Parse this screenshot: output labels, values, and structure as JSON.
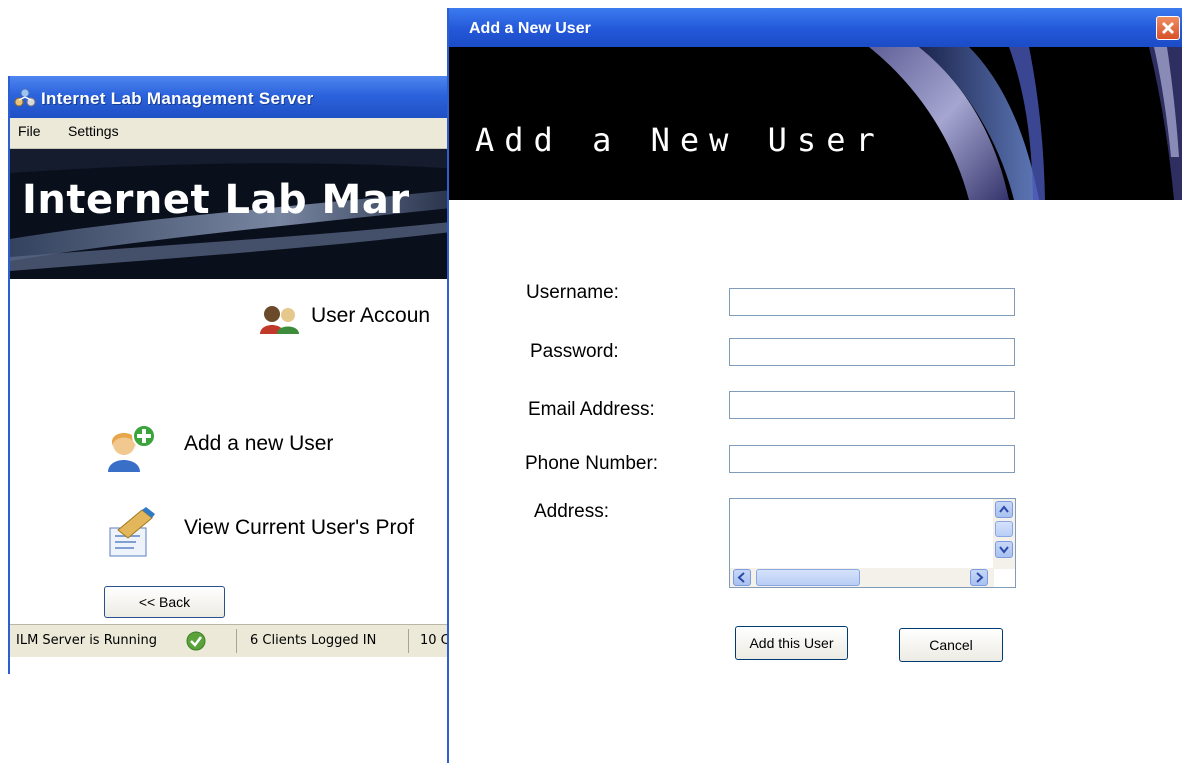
{
  "main_window": {
    "title": "Internet Lab Management Server",
    "menu": [
      "File",
      "Settings"
    ],
    "banner_text": "Internet Lab Mar",
    "section_heading": "User Accoun",
    "actions": [
      {
        "label": "Add a new User",
        "icon": "add-user-icon"
      },
      {
        "label": "View Current User's Prof",
        "icon": "edit-profile-icon"
      }
    ],
    "back_label": "<< Back",
    "status": {
      "server": "ILM Server is Running",
      "clients": "6 Clients Logged IN",
      "third": "10 C"
    }
  },
  "dialog": {
    "title": "Add a New User",
    "banner_text": "Add a New User",
    "fields": {
      "username": "Username:",
      "password": "Password:",
      "email": "Email Address:",
      "phone": "Phone Number:",
      "address": "Address:"
    },
    "add_label": "Add this User",
    "cancel_label": "Cancel"
  },
  "colors": {
    "titlebar_blue": "#2358d8",
    "close_orange": "#d8512a",
    "status_ok_green": "#5aa33a"
  }
}
